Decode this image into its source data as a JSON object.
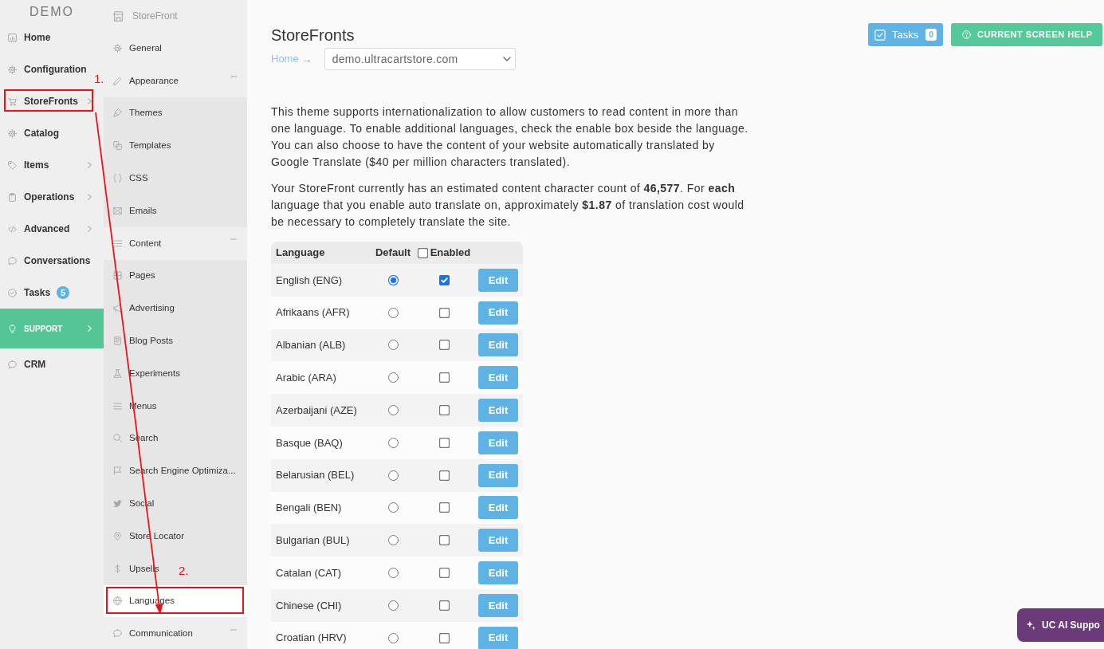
{
  "nav": {
    "brand": "DEMO",
    "items": [
      {
        "label": "Home",
        "kind": "link",
        "submenu": false,
        "annotated": false
      },
      {
        "label": "Configuration",
        "kind": "link",
        "submenu": false,
        "annotated": false
      },
      {
        "label": "StoreFronts",
        "kind": "link",
        "submenu": true,
        "annotated": true
      },
      {
        "label": "Catalog",
        "kind": "link",
        "submenu": false,
        "annotated": false
      },
      {
        "label": "Items",
        "kind": "link",
        "submenu": true,
        "annotated": false
      },
      {
        "label": "Operations",
        "kind": "link",
        "submenu": true,
        "annotated": false
      },
      {
        "label": "Advanced",
        "kind": "link",
        "submenu": true,
        "annotated": false
      },
      {
        "label": "Conversations",
        "kind": "link",
        "submenu": false,
        "annotated": false
      },
      {
        "label": "Tasks",
        "kind": "link",
        "submenu": false,
        "annotated": false,
        "badge": "5"
      },
      {
        "label": "SUPPORT",
        "kind": "support",
        "submenu": true,
        "annotated": false
      },
      {
        "label": "CRM",
        "kind": "link",
        "submenu": false,
        "annotated": false
      }
    ]
  },
  "subnav": {
    "title": "StoreFront",
    "items": [
      {
        "label": "General",
        "kind": "link",
        "selected": false,
        "annotated": false
      },
      {
        "label": "Appearance",
        "kind": "group",
        "selected": false,
        "annotated": false,
        "expanded": true,
        "children": [
          {
            "label": "Themes",
            "kind": "link",
            "selected": false,
            "annotated": false
          },
          {
            "label": "Templates",
            "kind": "link",
            "selected": false,
            "annotated": false
          },
          {
            "label": "CSS",
            "kind": "link",
            "selected": false,
            "annotated": false
          },
          {
            "label": "Emails",
            "kind": "link",
            "selected": false,
            "annotated": false
          }
        ]
      },
      {
        "label": "Content",
        "kind": "group",
        "selected": false,
        "annotated": false,
        "expanded": true,
        "children": [
          {
            "label": "Pages",
            "kind": "link",
            "selected": false,
            "annotated": false
          },
          {
            "label": "Advertising",
            "kind": "link",
            "selected": false,
            "annotated": false
          },
          {
            "label": "Blog Posts",
            "kind": "link",
            "selected": false,
            "annotated": false
          },
          {
            "label": "Experiments",
            "kind": "link",
            "selected": false,
            "annotated": false
          },
          {
            "label": "Menus",
            "kind": "link",
            "selected": false,
            "annotated": false
          },
          {
            "label": "Search",
            "kind": "link",
            "selected": false,
            "annotated": false
          },
          {
            "label": "Search Engine Optimiza...",
            "kind": "link",
            "selected": false,
            "annotated": false
          },
          {
            "label": "Social",
            "kind": "link",
            "selected": false,
            "annotated": false
          },
          {
            "label": "Store Locator",
            "kind": "link",
            "selected": false,
            "annotated": false
          },
          {
            "label": "Upsells",
            "kind": "link",
            "selected": false,
            "annotated": false
          },
          {
            "label": "Languages",
            "kind": "link",
            "selected": true,
            "annotated": true
          }
        ]
      },
      {
        "label": "Communication",
        "kind": "group",
        "selected": false,
        "annotated": false,
        "expanded": true
      }
    ]
  },
  "annotations": [
    {
      "label": "1."
    },
    {
      "label": "2."
    }
  ],
  "page_title": "StoreFronts",
  "toolbar": {
    "tasks_button": {
      "label": "Tasks",
      "count": "0"
    },
    "help_button": {
      "label": "CURRENT SCREEN HELP"
    }
  },
  "breadcrumb": [
    {
      "label": "Home",
      "separator": "→"
    }
  ],
  "store_select": {
    "value": "demo.ultracartstore.com"
  },
  "paragraphs": [
    "This theme supports internationalization to allow customers to read content in more than one language. To enable additional languages, check the enable box beside the language. You can also choose to have the content of your website automatically translated by Google Translate ($40 per million characters translated).",
    "Your StoreFront currently has an estimated content character count of **46,577**. For **each** language that you enable auto translate on, approximately **$1.87** of translation cost would be necessary to completely translate the site."
  ],
  "languages_table": {
    "columns": [
      {
        "label": "Language",
        "kind": "text"
      },
      {
        "label": "Default",
        "kind": "text"
      },
      {
        "label": "Enabled",
        "kind": "checkbox",
        "checked": false
      }
    ],
    "rows": [
      {
        "language": "English (ENG)",
        "selected": true,
        "checked": true,
        "action": "Edit"
      },
      {
        "language": "Afrikaans (AFR)",
        "selected": false,
        "checked": false,
        "action": "Edit"
      },
      {
        "language": "Albanian (ALB)",
        "selected": false,
        "checked": false,
        "action": "Edit"
      },
      {
        "language": "Arabic (ARA)",
        "selected": false,
        "checked": false,
        "action": "Edit"
      },
      {
        "language": "Azerbaijani (AZE)",
        "selected": false,
        "checked": false,
        "action": "Edit"
      },
      {
        "language": "Basque (BAQ)",
        "selected": false,
        "checked": false,
        "action": "Edit"
      },
      {
        "language": "Belarusian (BEL)",
        "selected": false,
        "checked": false,
        "action": "Edit"
      },
      {
        "language": "Bengali (BEN)",
        "selected": false,
        "checked": false,
        "action": "Edit"
      },
      {
        "language": "Bulgarian (BUL)",
        "selected": false,
        "checked": false,
        "action": "Edit"
      },
      {
        "language": "Catalan (CAT)",
        "selected": false,
        "checked": false,
        "action": "Edit"
      },
      {
        "language": "Chinese (CHI)",
        "selected": false,
        "checked": false,
        "action": "Edit"
      },
      {
        "language": "Croatian (HRV)",
        "selected": false,
        "checked": false,
        "action": "Edit"
      }
    ]
  },
  "chat_button": {
    "label": "UC AI Suppo"
  }
}
